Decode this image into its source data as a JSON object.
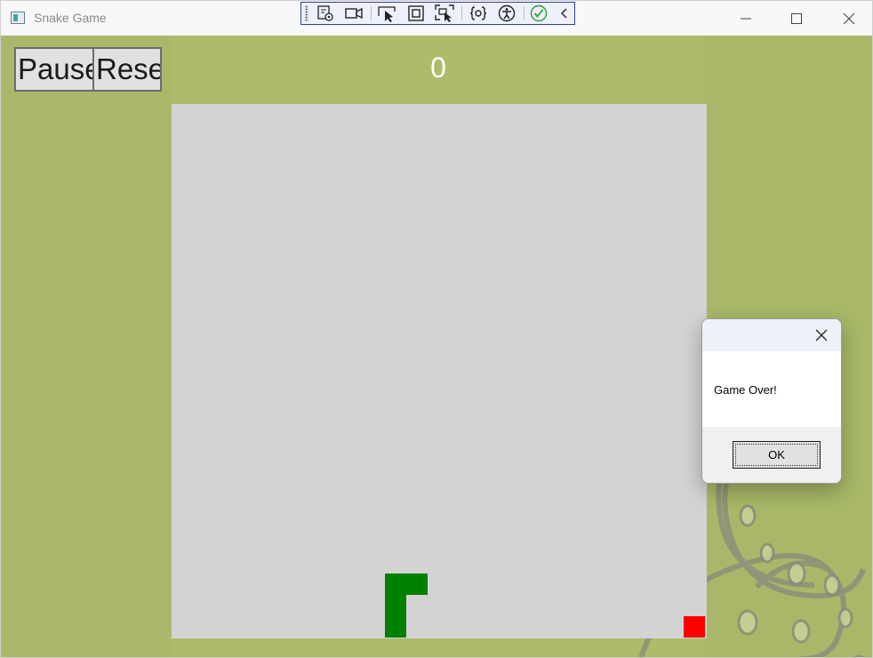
{
  "window": {
    "title": "Snake Game"
  },
  "debug_toolbar": {
    "items": [
      "live-visual-tree-icon",
      "record-icon",
      "select-element-icon",
      "display-layout-adorners-icon",
      "track-focus-icon",
      "binding-failures-icon",
      "accessibility-icon",
      "checkmark-icon",
      "collapse-chevron-icon"
    ]
  },
  "controls": {
    "pause_label": "Pause",
    "reset_label": "Reset"
  },
  "score": {
    "value": "0"
  },
  "board": {
    "background": "#d3d3d3",
    "grid_cells": 25,
    "snake_color": "#008000",
    "food_color": "#ff0000",
    "snake": [
      [
        10,
        22
      ],
      [
        11,
        22
      ],
      [
        10,
        23
      ],
      [
        10,
        24
      ]
    ],
    "food": [
      [
        24,
        24
      ]
    ]
  },
  "dialog": {
    "message": "Game Over!",
    "ok_label": "OK"
  },
  "colors": {
    "background": "#adbb6a",
    "score_text": "#ffffff"
  }
}
